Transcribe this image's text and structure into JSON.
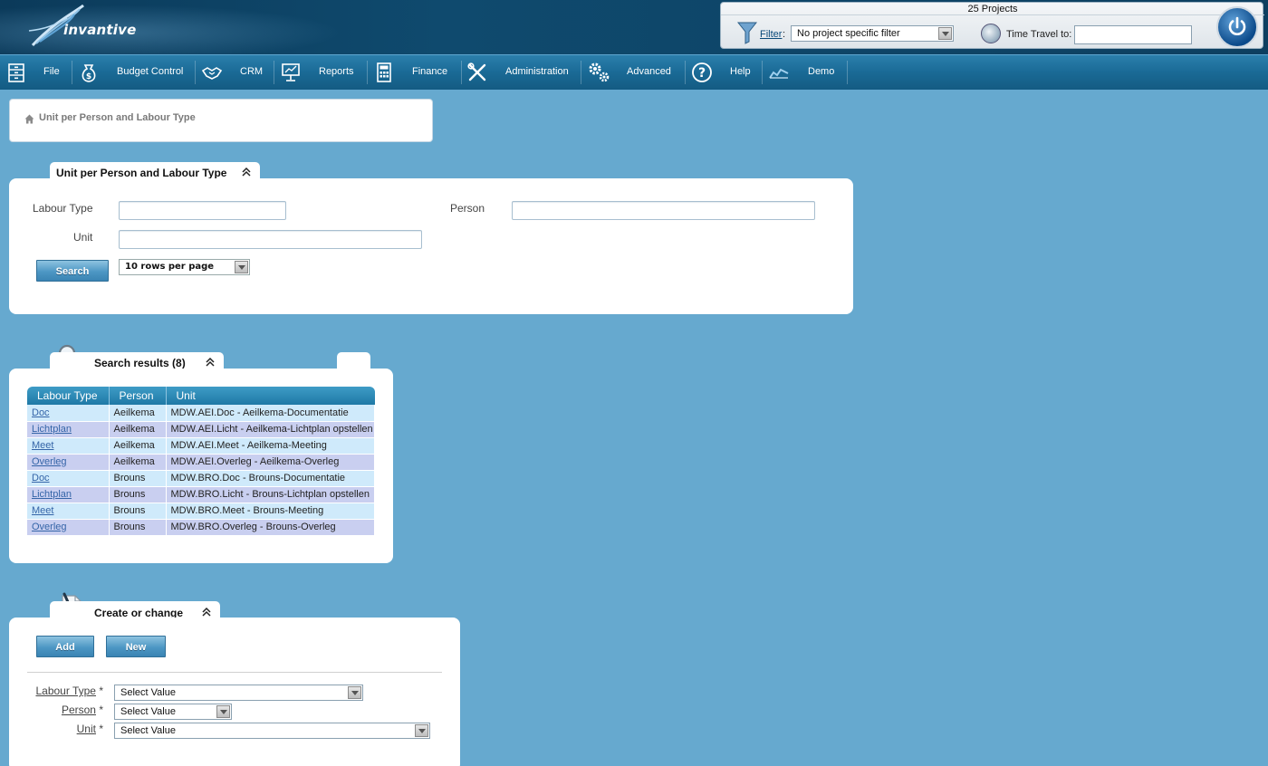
{
  "header": {
    "logo_text": "invantive",
    "projects_count": "25 Projects",
    "filter_label": "Filter",
    "filter_colon": ":",
    "filter_value": "No project specific filter",
    "time_travel_label": "Time Travel to:",
    "time_travel_value": ""
  },
  "menu": [
    {
      "label": "File",
      "icon": "cabinet-icon"
    },
    {
      "label": "Budget Control",
      "icon": "money-bag-icon"
    },
    {
      "label": "CRM",
      "icon": "handshake-icon"
    },
    {
      "label": "Reports",
      "icon": "presentation-board-icon"
    },
    {
      "label": "Finance",
      "icon": "calculator-icon"
    },
    {
      "label": "Administration",
      "icon": "tools-icon"
    },
    {
      "label": "Advanced",
      "icon": "gears-icon"
    },
    {
      "label": "Help",
      "icon": "help-icon"
    },
    {
      "label": "Demo",
      "icon": "demo-icon"
    }
  ],
  "breadcrumb": {
    "label": "Unit per Person and Labour Type"
  },
  "search_panel": {
    "title": "Unit per Person and Labour Type",
    "labour_type_label": "Labour Type",
    "person_label": "Person",
    "unit_label": "Unit",
    "search_button": "Search",
    "rows_per_page": "10 rows per page"
  },
  "results_panel": {
    "title": "Search results (8)",
    "columns": [
      "Labour Type",
      "Person",
      "Unit"
    ],
    "rows": [
      {
        "labour_type": "Doc",
        "person": "Aeilkema",
        "unit": "MDW.AEI.Doc - Aeilkema-Documentatie"
      },
      {
        "labour_type": "Lichtplan",
        "person": "Aeilkema",
        "unit": "MDW.AEI.Licht - Aeilkema-Lichtplan opstellen"
      },
      {
        "labour_type": "Meet",
        "person": "Aeilkema",
        "unit": "MDW.AEI.Meet - Aeilkema-Meeting"
      },
      {
        "labour_type": "Overleg",
        "person": "Aeilkema",
        "unit": "MDW.AEI.Overleg - Aeilkema-Overleg"
      },
      {
        "labour_type": "Doc",
        "person": "Brouns",
        "unit": "MDW.BRO.Doc - Brouns-Documentatie"
      },
      {
        "labour_type": "Lichtplan",
        "person": "Brouns",
        "unit": "MDW.BRO.Licht - Brouns-Lichtplan opstellen"
      },
      {
        "labour_type": "Meet",
        "person": "Brouns",
        "unit": "MDW.BRO.Meet - Brouns-Meeting"
      },
      {
        "labour_type": "Overleg",
        "person": "Brouns",
        "unit": "MDW.BRO.Overleg - Brouns-Overleg"
      }
    ]
  },
  "create_panel": {
    "title": "Create or change",
    "add_button": "Add",
    "new_button": "New",
    "labour_type_label": "Labour Type",
    "person_label": "Person",
    "unit_label": "Unit",
    "required_marker": "*",
    "labour_type_value": "Select Value",
    "person_value": "Select Value",
    "unit_value": "Select Value"
  },
  "colors": {
    "page_background": "#66a9cf",
    "menubar": "#1a6a96",
    "header": "#0f4a6e",
    "table_header": "#1f79a6",
    "row_odd": "#cfeafb",
    "row_even": "#c9cff0",
    "link": "#3565a8"
  }
}
